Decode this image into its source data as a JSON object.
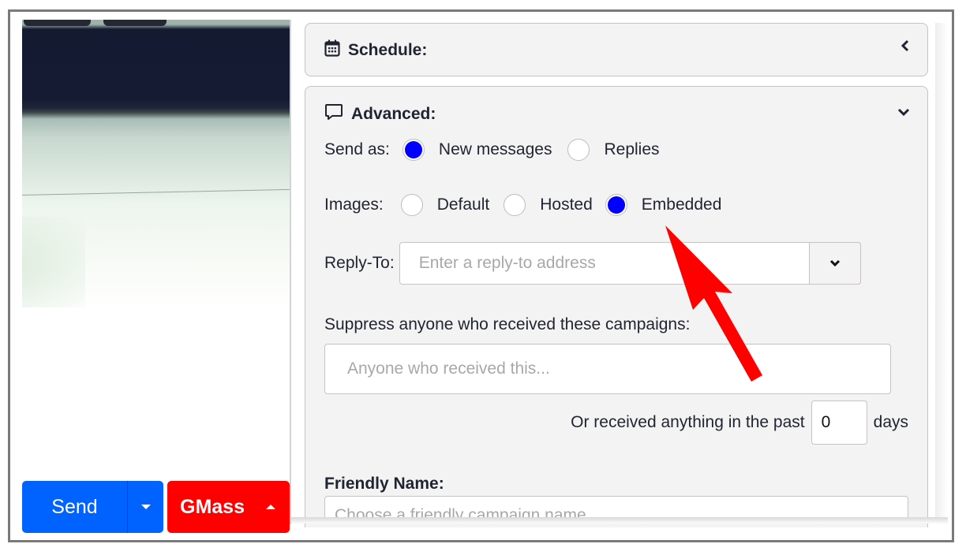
{
  "compose": {
    "send_label": "Send",
    "gmass_label": "GMass",
    "colors": {
      "send": "#0062ff",
      "gmass": "#ff0000"
    }
  },
  "schedule": {
    "title": "Schedule:",
    "icon": "calendar-icon",
    "toggle_icon": "chevron-left-icon"
  },
  "advanced": {
    "title": "Advanced:",
    "icon": "speech-bubble-icon",
    "toggle_icon": "chevron-down-icon",
    "send_as": {
      "label": "Send as:",
      "options": [
        {
          "label": "New messages",
          "checked": true
        },
        {
          "label": "Replies",
          "checked": false
        }
      ]
    },
    "images": {
      "label": "Images:",
      "options": [
        {
          "label": "Default",
          "checked": false
        },
        {
          "label": "Hosted",
          "checked": false
        },
        {
          "label": "Embedded",
          "checked": true
        }
      ]
    },
    "reply_to": {
      "label": "Reply-To:",
      "placeholder": "Enter a reply-to address",
      "value": ""
    },
    "suppress": {
      "label": "Suppress anyone who received these campaigns:",
      "placeholder": "Anyone who received this...",
      "past_prefix": "Or received anything in the past",
      "days_value": "0",
      "days_suffix": "days"
    },
    "friendly_name": {
      "label": "Friendly Name:",
      "placeholder": "Choose a friendly campaign name"
    },
    "accent_color": "#0000ff"
  },
  "annotation": {
    "type": "arrow",
    "color": "#ff0000",
    "points_to": "Embedded"
  }
}
